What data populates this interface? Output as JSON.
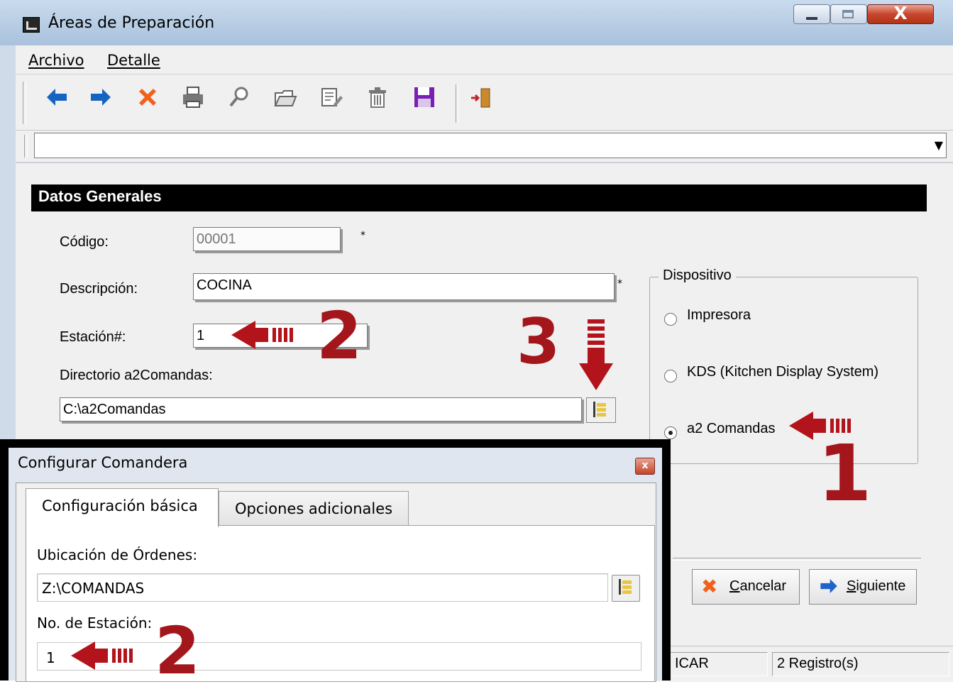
{
  "window": {
    "title": "Áreas de Preparación",
    "close_glyph": "X"
  },
  "menu": {
    "archivo": "Archivo",
    "detalle": "Detalle"
  },
  "toolbar": {
    "icons": [
      "arrow-left-icon",
      "arrow-right-icon",
      "cancel-x-icon",
      "printer-icon",
      "search-icon",
      "open-folder-icon",
      "edit-icon",
      "trash-icon",
      "save-disk-icon",
      "exit-door-icon"
    ],
    "colors": {
      "arrows": "#1565c0",
      "cancel": "#f0621c",
      "save": "#7a1fb3",
      "exit": "#c1272d"
    }
  },
  "form": {
    "section_title": "Datos Generales",
    "codigo_label": "Código:",
    "codigo_value": "00001",
    "required_mark": "*",
    "descripcion_label": "Descripción:",
    "descripcion_value": "COCINA",
    "estacion_label": "Estación#:",
    "estacion_value": "1",
    "directorio_label": "Directorio a2Comandas:",
    "directorio_value": "C:\\a2Comandas"
  },
  "dispositivo": {
    "legend": "Dispositivo",
    "options": [
      {
        "label": "Impresora",
        "checked": false
      },
      {
        "label": "KDS (Kitchen Display System)",
        "checked": false
      },
      {
        "label": "a2 Comandas",
        "checked": true
      }
    ]
  },
  "buttons": {
    "cancel_prefix": "",
    "cancel_label_u": "C",
    "cancel_label_rest": "ancelar",
    "next_label_u": "S",
    "next_label_rest": "iguiente"
  },
  "status": {
    "cell1": "ICAR",
    "cell2": "2 Registro(s)"
  },
  "annotations": {
    "n1": "1",
    "n2": "2",
    "n3": "3",
    "n2b": "2",
    "accent": "#a3161c"
  },
  "dialog": {
    "title": "Configurar Comandera",
    "close_glyph": "x",
    "tabs": [
      "Configuración básica",
      "Opciones adicionales"
    ],
    "ubicacion_label": "Ubicación de Órdenes:",
    "ubicacion_value": "Z:\\COMANDAS",
    "estacion_label": "No. de Estación:",
    "estacion_value": "1"
  }
}
